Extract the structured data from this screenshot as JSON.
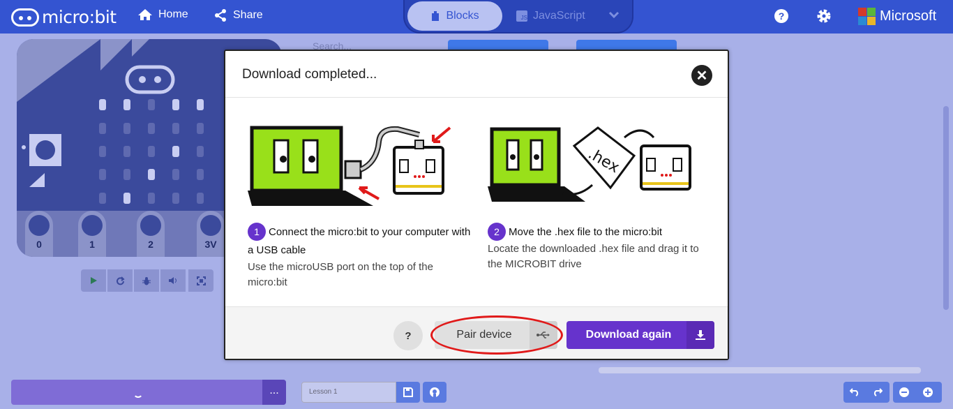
{
  "topbar": {
    "logo": "micro:bit",
    "home": "Home",
    "share": "Share",
    "tab_blocks": "Blocks",
    "tab_js": "JavaScript",
    "microsoft": "Microsoft"
  },
  "workspace": {
    "search_placeholder": "Search..."
  },
  "simulator": {
    "pins": [
      "0",
      "1",
      "2",
      "3V"
    ]
  },
  "bottombar": {
    "more": "...",
    "project_name": "Lesson 1"
  },
  "dialog": {
    "title": "Download completed...",
    "step1": {
      "number": "1",
      "heading": "Connect the micro:bit to your computer with a USB cable",
      "description": "Use the microUSB port on the top of the micro:bit"
    },
    "step2": {
      "number": "2",
      "heading": "Move the .hex file to the micro:bit",
      "description": "Locate the downloaded .hex file and drag it to the MICROBIT drive",
      "file_label": ".hex"
    },
    "help_label": "?",
    "pair_label": "Pair device",
    "download_label": "Download again"
  },
  "colors": {
    "topbar": "#3454d1",
    "accent_purple": "#6633cc",
    "highlight_ring": "#e01a1a"
  }
}
